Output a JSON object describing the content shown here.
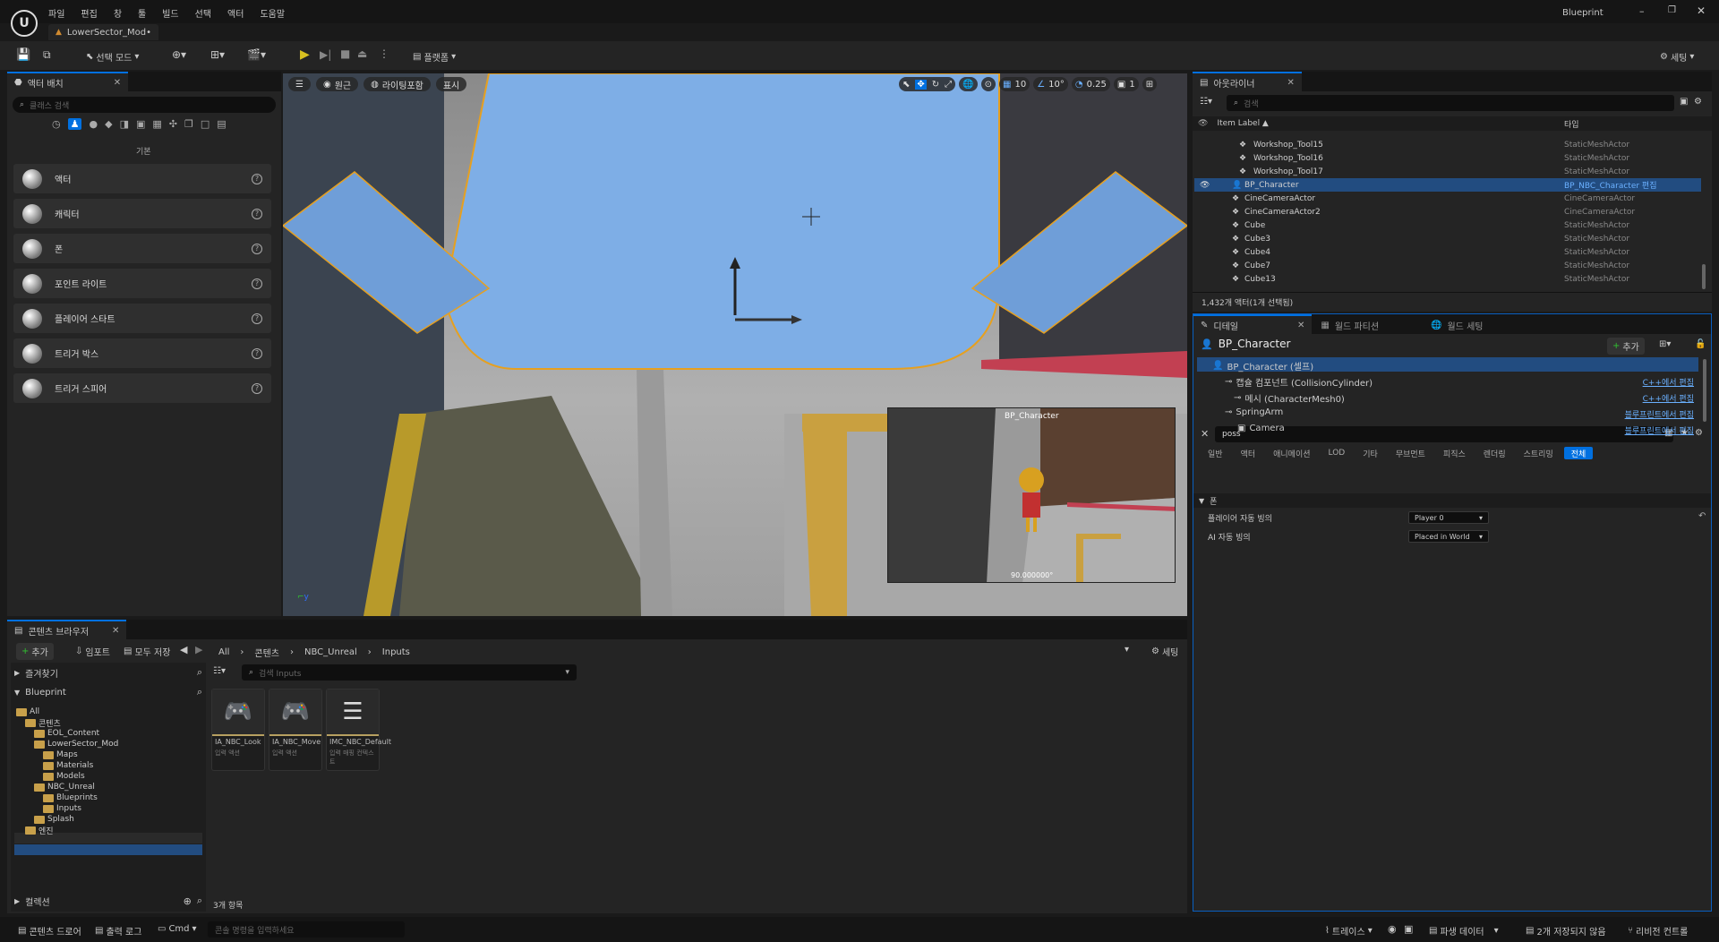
{
  "menu": {
    "items": [
      "파일",
      "편집",
      "창",
      "툴",
      "빌드",
      "선택",
      "액터",
      "도움말"
    ],
    "tab_title": "LowerSector_Mod•",
    "app_title": "Blueprint"
  },
  "toolbar": {
    "select_mode": "선택 모드",
    "platforms": "플랫폼",
    "settings": "세팅"
  },
  "place_actors": {
    "tab": "액터 배치",
    "search_placeholder": "클래스 검색",
    "section": "기본",
    "items": [
      "액터",
      "캐릭터",
      "폰",
      "포인트 라이트",
      "플레이어 스타트",
      "트리거 박스",
      "트리거 스피어"
    ]
  },
  "viewport": {
    "perspective": "원근",
    "lit": "라이팅포함",
    "show": "표시",
    "grid": "10",
    "angle": "10°",
    "scale": "0.25",
    "camera_speed": "1",
    "pip_label": "BP_Character",
    "pip_fov": "90.000000°"
  },
  "outliner": {
    "tab": "아웃라이너",
    "search_placeholder": "검색",
    "col_label": "Item Label ▲",
    "col_type": "타입",
    "rows": [
      {
        "name": "Workshop_Tool15",
        "type": "StaticMeshActor",
        "indent": 1,
        "selected": false
      },
      {
        "name": "Workshop_Tool16",
        "type": "StaticMeshActor",
        "indent": 1,
        "selected": false
      },
      {
        "name": "Workshop_Tool17",
        "type": "StaticMeshActor",
        "indent": 1,
        "selected": false
      },
      {
        "name": "BP_Character",
        "type": "BP_NBC_Character 편집",
        "indent": 0,
        "selected": true
      },
      {
        "name": "CineCameraActor",
        "type": "CineCameraActor",
        "indent": 0,
        "selected": false
      },
      {
        "name": "CineCameraActor2",
        "type": "CineCameraActor",
        "indent": 0,
        "selected": false
      },
      {
        "name": "Cube",
        "type": "StaticMeshActor",
        "indent": 0,
        "selected": false
      },
      {
        "name": "Cube3",
        "type": "StaticMeshActor",
        "indent": 0,
        "selected": false
      },
      {
        "name": "Cube4",
        "type": "StaticMeshActor",
        "indent": 0,
        "selected": false
      },
      {
        "name": "Cube7",
        "type": "StaticMeshActor",
        "indent": 0,
        "selected": false
      },
      {
        "name": "Cube13",
        "type": "StaticMeshActor",
        "indent": 0,
        "selected": false
      }
    ],
    "status": "1,432개 액터(1개 선택됨)"
  },
  "details": {
    "tabs": [
      "디테일",
      "월드 파티션",
      "월드 세팅"
    ],
    "actor_name": "BP_Character",
    "add_label": "추가",
    "components": [
      {
        "name": "BP_Character (셀프)",
        "link": ""
      },
      {
        "name": "캡슐 컴포넌트 (CollisionCylinder)",
        "link": "C++에서 편집"
      },
      {
        "name": "메시 (CharacterMesh0)",
        "link": "C++에서 편집"
      },
      {
        "name": "SpringArm",
        "link": "블루프린트에서 편집"
      },
      {
        "name": "Camera",
        "link": "블루프린트에서 편집"
      }
    ],
    "filter_value": "poss",
    "categories": [
      "일반",
      "액터",
      "애니메이션",
      "LOD",
      "기타",
      "무브먼트",
      "피직스",
      "렌더링",
      "스트리밍",
      "전체"
    ],
    "section": "폰",
    "props": [
      {
        "label": "플레이어 자동 빙의",
        "value": "Player 0"
      },
      {
        "label": "AI 자동 빙의",
        "value": "Placed in World"
      }
    ]
  },
  "content_browser": {
    "tab": "콘텐츠 브라우저",
    "add": "추가",
    "import": "임포트",
    "save_all": "모두 저장",
    "breadcrumb": [
      "All",
      "콘텐츠",
      "NBC_Unreal",
      "Inputs"
    ],
    "settings": "세팅",
    "favorites": "즐겨찾기",
    "project": "Blueprint",
    "search_placeholder": "검색 Inputs",
    "tree": [
      {
        "label": "All",
        "level": 0
      },
      {
        "label": "콘텐츠",
        "level": 1
      },
      {
        "label": "EOL_Content",
        "level": 2
      },
      {
        "label": "LowerSector_Mod",
        "level": 2
      },
      {
        "label": "Maps",
        "level": 3
      },
      {
        "label": "Materials",
        "level": 3
      },
      {
        "label": "Models",
        "level": 3
      },
      {
        "label": "NBC_Unreal",
        "level": 2
      },
      {
        "label": "Blueprints",
        "level": 3
      },
      {
        "label": "Inputs",
        "level": 3
      },
      {
        "label": "Splash",
        "level": 2
      },
      {
        "label": "엔진",
        "level": 1
      }
    ],
    "assets": [
      {
        "name": "IA_NBC_Look",
        "sub": "입력 액션"
      },
      {
        "name": "IA_NBC_Move",
        "sub": "입력 액션"
      },
      {
        "name": "IMC_NBC_Default",
        "sub": "입력 매핑 컨텍스트"
      }
    ],
    "collections": "컬렉션",
    "count": "3개 항목"
  },
  "statusbar": {
    "drawer": "콘텐츠 드로어",
    "output_log": "출력 로그",
    "cmd": "Cmd",
    "console_placeholder": "콘솔 명령을 입력하세요",
    "trace": "트레이스",
    "derived_data": "파생 데이터",
    "unsaved": "2개 저장되지 않음",
    "revision": "리비전 컨트롤"
  }
}
